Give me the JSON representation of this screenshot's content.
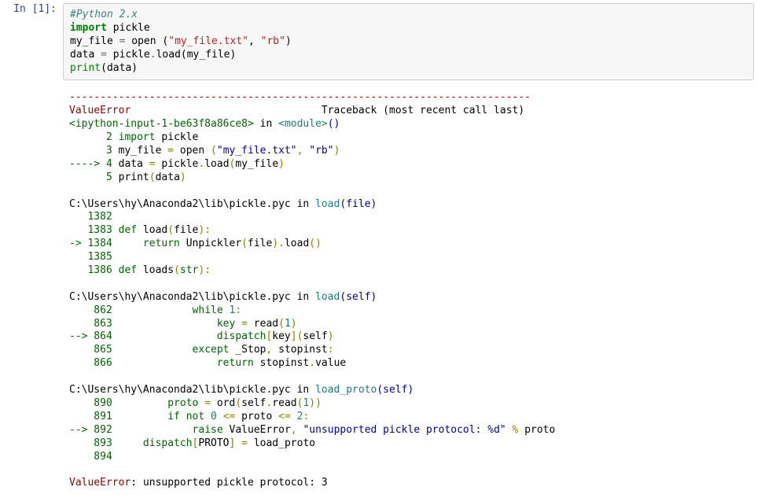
{
  "prompt": {
    "in": "In [1]:"
  },
  "code": {
    "l1_comment": "#Python 2.x",
    "l2_kw": "import",
    "l2_mod": "pickle",
    "l3_a": "my_file ",
    "l3_eq": "=",
    "l3_b": " open (",
    "l3_s1": "\"my_file.txt\"",
    "l3_c": ", ",
    "l3_s2": "\"rb\"",
    "l3_d": ")",
    "l4_a": "data ",
    "l4_eq": "=",
    "l4_b": " pickle",
    "l4_c": ".",
    "l4_d": "load(my_file)",
    "l5_a": "print",
    "l5_b": "(",
    "l5_c": "data",
    "l5_d": ")"
  },
  "out": {
    "dashes": "---------------------------------------------------------------------------",
    "err_name": "ValueError",
    "tb_label": "                               Traceback (most recent call last)",
    "l_ipy_a": "<ipython-input-1-be63f8a86ce8>",
    "l_ipy_b": " in ",
    "l_ipy_c": "<module>",
    "l_ipy_d": "()",
    "ln2_pre": "      2",
    "ln2_imp": " import",
    "ln2_b": " pickle",
    "ln3_pre": "      3",
    "ln3_a": " my_file ",
    "ln3_eq": "=",
    "ln3_b": " open ",
    "ln3_p1": "(",
    "ln3_s1": "\"my_file.txt\"",
    "ln3_c": ",",
    "ln3_sp": " ",
    "ln3_s2": "\"rb\"",
    "ln3_p2": ")",
    "ln4_arr": "----> 4",
    "ln4_a": " data ",
    "ln4_eq": "=",
    "ln4_b": " pickle",
    "ln4_dot": ".",
    "ln4_c": "load",
    "ln4_p1": "(",
    "ln4_d": "my_file",
    "ln4_p2": ")",
    "ln5_pre": "      5",
    "ln5_a": " print",
    "ln5_p1": "(",
    "ln5_b": "data",
    "ln5_p2": ")",
    "f1_path": "C:\\Users\\hy\\Anaconda2\\lib\\pickle.pyc",
    "f1_in": " in ",
    "f1_fn": "load",
    "f1_p1": "(file)",
    "f1_l1": "   1382",
    "f1_l2a": "   1383 ",
    "f1_l2def": "def",
    "f1_l2b": " load",
    "f1_l2p": "(",
    "f1_l2c": "file",
    "f1_l2q": "):",
    "f1_l3a": "-> 1384     ",
    "f1_l3ret": "return",
    "f1_l3b": " Unpickler",
    "f1_l3p": "(",
    "f1_l3c": "file",
    "f1_l3q": ").",
    "f1_l3d": "load",
    "f1_l3r": "()",
    "f1_l4": "   1385",
    "f1_l5a": "   1386 ",
    "f1_l5def": "def",
    "f1_l5b": " loads",
    "f1_l5p": "(",
    "f1_l5d": "str",
    "f1_l5q": "):",
    "f2_path": "C:\\Users\\hy\\Anaconda2\\lib\\pickle.pyc",
    "f2_in": " in ",
    "f2_fn": "load",
    "f2_p1": "(self)",
    "f2_l1a": "    862             ",
    "f2_l1w": "while",
    "f2_l1b": " ",
    "f2_l1n": "1",
    "f2_l1c": ":",
    "f2_l2a": "    863                 key ",
    "f2_l2eq": "=",
    "f2_l2b": " read",
    "f2_l2p": "(",
    "f2_l2n": "1",
    "f2_l2q": ")",
    "f2_l3a": "--> 864                 dispatch",
    "f2_l3p": "[",
    "f2_l3b": "key",
    "f2_l3q": "](",
    "f2_l3c": "self",
    "f2_l3r": ")",
    "f2_l4a": "    865             ",
    "f2_l4ex": "except",
    "f2_l4b": " _Stop",
    "f2_l4c": ",",
    "f2_l4d": " stopinst",
    "f2_l4e": ":",
    "f2_l5a": "    866                 ",
    "f2_l5ret": "return",
    "f2_l5b": " stopinst",
    "f2_l5c": ".",
    "f2_l5d": "value",
    "f3_path": "C:\\Users\\hy\\Anaconda2\\lib\\pickle.pyc",
    "f3_in": " in ",
    "f3_fn": "load_proto",
    "f3_p1": "(self)",
    "f3_l1a": "    890         proto ",
    "f3_l1eq": "=",
    "f3_l1b": " ord",
    "f3_l1p": "(",
    "f3_l1c": "self",
    "f3_l1q": ".",
    "f3_l1d": "read",
    "f3_l1r": "(",
    "f3_l1n": "1",
    "f3_l1s": "))",
    "f3_l2a": "    891         ",
    "f3_l2if": "if",
    "f3_l2b": " ",
    "f3_l2not": "not",
    "f3_l2c": " ",
    "f3_l2z": "0",
    "f3_l2d": " ",
    "f3_l2le1": "<=",
    "f3_l2e": " proto ",
    "f3_l2le2": "<=",
    "f3_l2f": " ",
    "f3_l2two": "2",
    "f3_l2g": ":",
    "f3_l3a": "--> 892             ",
    "f3_l3r": "raise",
    "f3_l3b": " ValueError",
    "f3_l3c": ",",
    "f3_l3d": " ",
    "f3_l3s": "\"unsupported pickle protocol: %d\"",
    "f3_l3e": " ",
    "f3_l3pc": "%",
    "f3_l3f": " proto",
    "f3_l4a": "    893     dispatch",
    "f3_l4p": "[",
    "f3_l4b": "PROTO",
    "f3_l4q": "]",
    "f3_l4c": " ",
    "f3_l4eq": "=",
    "f3_l4d": " load_proto",
    "f3_l5": "    894",
    "final_err": "ValueError",
    "final_colon": ": ",
    "final_msg": "unsupported pickle protocol: 3"
  }
}
